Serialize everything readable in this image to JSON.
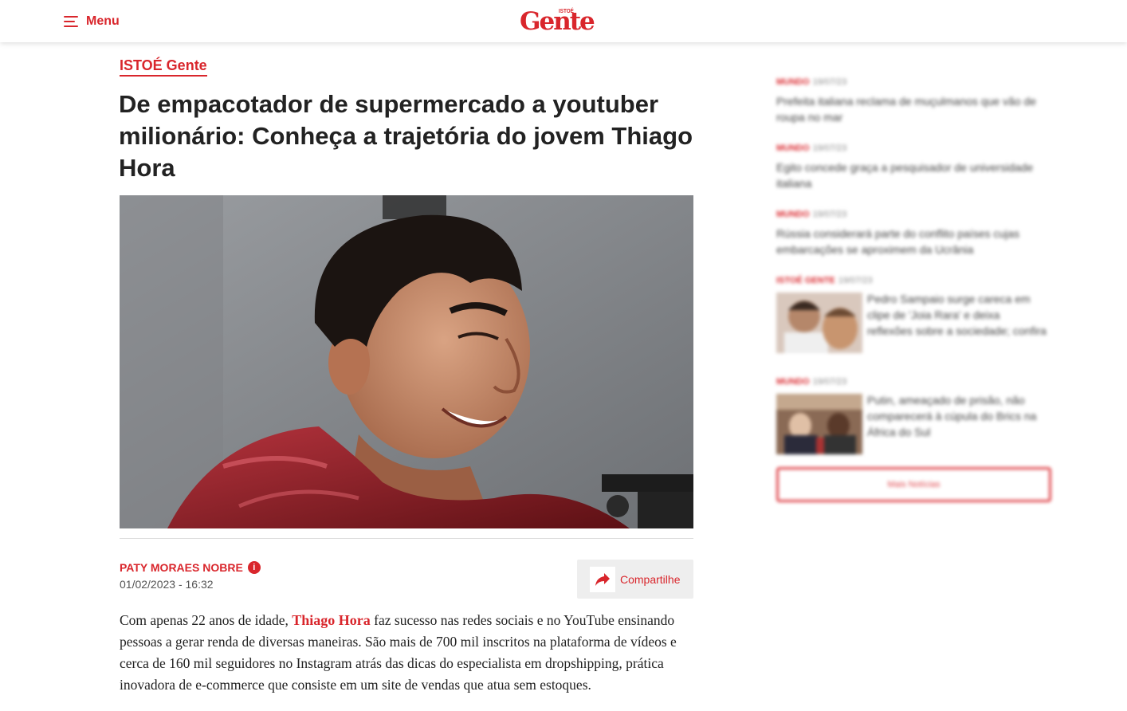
{
  "header": {
    "menu_label": "Menu",
    "logo_small": "ISTOÉ",
    "logo_text": "Gente"
  },
  "article": {
    "section": "ISTOÉ Gente",
    "headline": "De empacotador de supermercado a youtuber milionário: Conheça a trajetória do jovem Thiago Hora",
    "author": "PATY MORAES NOBRE",
    "author_info_glyph": "i",
    "date": "01/02/2023 - 16:32",
    "share_label": "Compartilhe",
    "body_before": "Com apenas 22 anos de idade, ",
    "body_link": "Thiago Hora",
    "body_after": " faz sucesso nas redes sociais e no YouTube ensinando pessoas a gerar renda de diversas maneiras. São mais de 700 mil inscritos na plataforma de vídeos e cerca de 160 mil seguidores no Instagram atrás das dicas do especialista em dropshipping, prática inovadora de e-commerce que consiste em um site de vendas que atua sem estoques."
  },
  "sidebar": {
    "items": [
      {
        "category": "MUNDO",
        "time": "19/07/23",
        "title": "Prefeita italiana reclama de muçulmanos que vão de roupa no mar"
      },
      {
        "category": "MUNDO",
        "time": "19/07/23",
        "title": "Egito concede graça a pesquisador de universidade italiana"
      },
      {
        "category": "MUNDO",
        "time": "19/07/23",
        "title": "Rússia considerará parte do conflito países cujas embarcações se aproximem da Ucrânia"
      },
      {
        "category": "ISTOÉ GENTE",
        "time": "19/07/23",
        "title": "Pedro Sampaio surge careca em clipe de 'Joia Rara' e deixa reflexões sobre a sociedade; confira"
      },
      {
        "category": "MUNDO",
        "time": "19/07/23",
        "title": "Putin, ameaçado de prisão, não comparecerá à cúpula do Brics na África do Sul"
      }
    ],
    "more_label": "Mais Notícias"
  },
  "colors": {
    "accent": "#d9262c",
    "text": "#222222",
    "muted": "#555555"
  },
  "icons": {
    "menu": "hamburger-icon",
    "share": "share-arrow-icon",
    "info": "info-icon"
  }
}
